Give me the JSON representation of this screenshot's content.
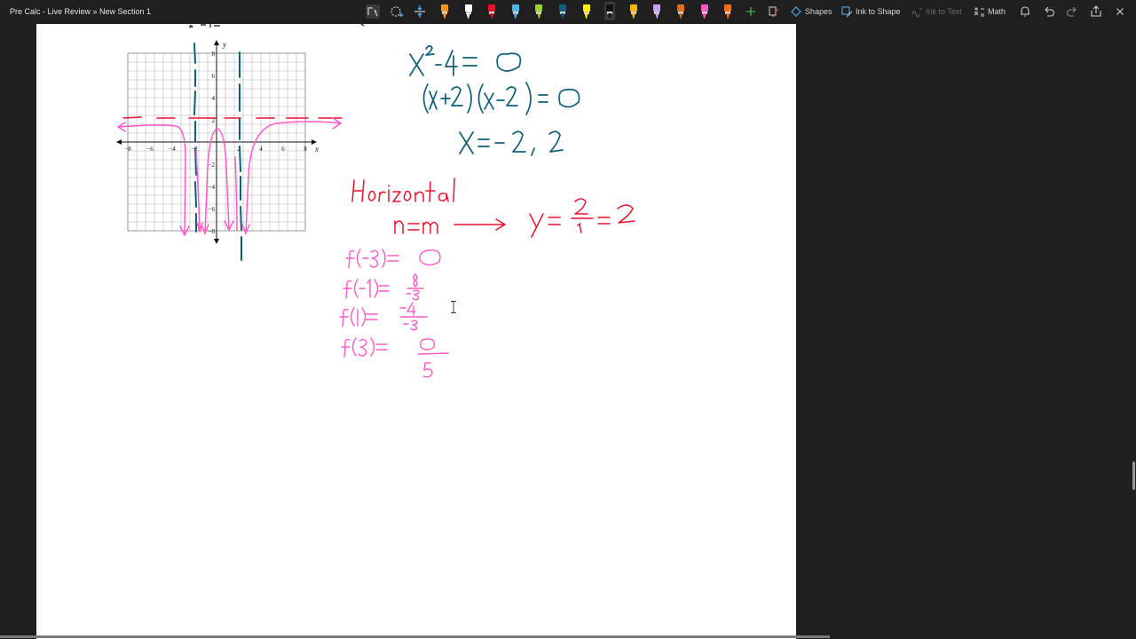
{
  "window": {
    "title": "Pre Calc - Live Review » New Section 1"
  },
  "toolbar": {
    "shapes_label": "Shapes",
    "ink_to_shape_label": "Ink to Shape",
    "ink_to_text_label": "Ink to Text",
    "math_label": "Math",
    "pens": [
      {
        "name": "pen-orange",
        "color": "#f7941d"
      },
      {
        "name": "pen-white",
        "color": "#ffffff"
      },
      {
        "name": "pen-red",
        "color": "#e81123"
      },
      {
        "name": "pen-light-blue",
        "color": "#4fb3e8"
      },
      {
        "name": "pen-lime",
        "color": "#9bd22f"
      },
      {
        "name": "pen-teal",
        "color": "#0f5f78"
      },
      {
        "name": "pen-yellow-highlighter",
        "color": "#fff100"
      },
      {
        "name": "pen-black",
        "color": "#111111"
      },
      {
        "name": "pen-gold",
        "color": "#f7b500"
      },
      {
        "name": "pen-lavender",
        "color": "#c8a2f0"
      },
      {
        "name": "pen-dark-orange",
        "color": "#e06e1a"
      },
      {
        "name": "pen-pink",
        "color": "#ff5ac8"
      },
      {
        "name": "pen-orange-red",
        "color": "#ff6a13"
      }
    ],
    "selected_pen_index": 7,
    "icons": [
      "lasso-select-icon",
      "lasso-add-icon",
      "insert-space-icon",
      "add-pen-icon",
      "ink-replay-icon",
      "shapes-icon",
      "ink-to-shape-icon",
      "ink-to-text-icon",
      "math-icon",
      "bell-icon",
      "undo-icon",
      "redo-icon",
      "share-icon",
      "more-icon"
    ]
  },
  "graph": {
    "x_ticks": [
      "−8",
      "−6",
      "−4",
      "−2",
      "2",
      "4",
      "6",
      "8"
    ],
    "y_ticks": [
      "8",
      "6",
      "4",
      "2",
      "−2",
      "−4",
      "−6",
      "−8"
    ],
    "x_axis_label": "x",
    "y_axis_label": "y"
  },
  "notes": {
    "colors": {
      "teal": "#0f5f78",
      "red": "#e8112d",
      "pink": "#ff5ac8"
    }
  }
}
